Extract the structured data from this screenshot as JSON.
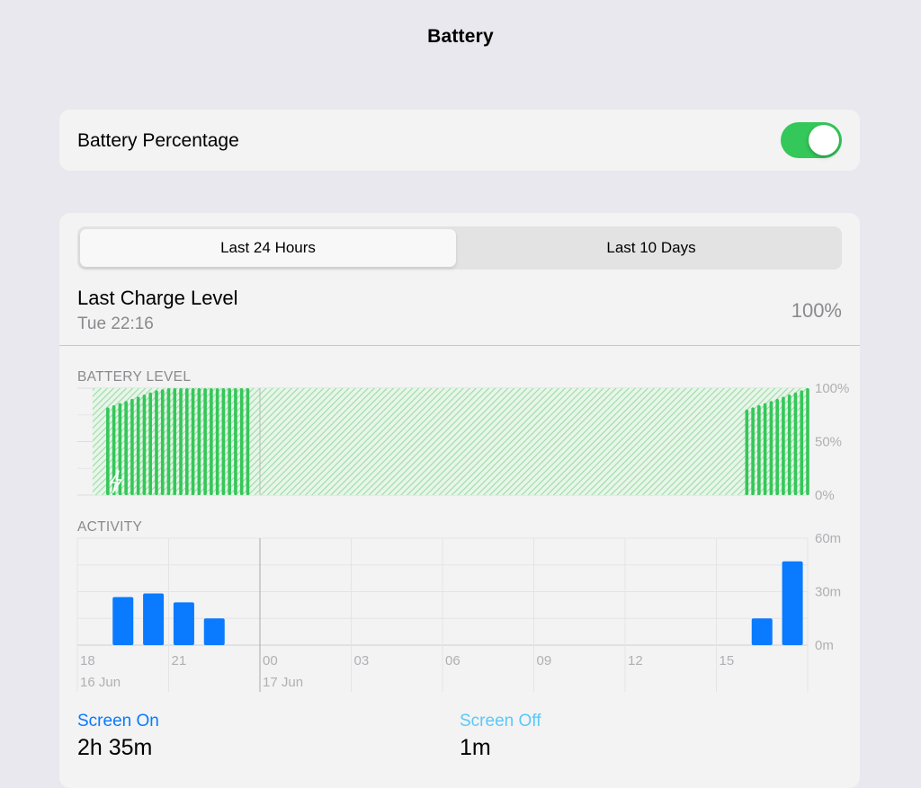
{
  "nav": {
    "title": "Battery"
  },
  "battery_percentage": {
    "label": "Battery Percentage",
    "enabled": true
  },
  "segmented": {
    "selected": "Last 24 Hours",
    "other": "Last 10 Days"
  },
  "last_charge": {
    "title": "Last Charge Level",
    "date": "Tue 22:16",
    "value": "100%"
  },
  "colors": {
    "battery_green": "#34c759",
    "hatch_green": "#bfe8c4",
    "activity_blue": "#0a7aff",
    "screen_off_blue": "#5ac8fa"
  },
  "charts": {
    "battery_label": "BATTERY LEVEL",
    "activity_label": "ACTIVITY",
    "battery_y_ticks": [
      "100%",
      "50%",
      "0%"
    ],
    "activity_y_ticks": [
      "60m",
      "30m",
      "0m"
    ],
    "x_ticks": [
      "18",
      "21",
      "00",
      "03",
      "06",
      "09",
      "12",
      "15"
    ],
    "x_dates": [
      "16 Jun",
      "17 Jun"
    ]
  },
  "chart_data": [
    {
      "type": "bar",
      "title": "BATTERY LEVEL",
      "unit": "%",
      "ylim": [
        0,
        100
      ],
      "y_ticks": [
        "0%",
        "50%",
        "100%"
      ],
      "x_ticks": [
        "18",
        "21",
        "00",
        "03",
        "06",
        "09",
        "12",
        "15"
      ],
      "x_dates": [
        "16 Jun",
        "17 Jun"
      ],
      "x_range_hours": [
        18,
        42
      ],
      "charging_period_hours": [
        18.5,
        42
      ],
      "series": [
        {
          "x_hours": [
            19.0,
            19.2,
            19.4,
            19.6,
            19.8,
            20.0,
            20.2,
            20.4,
            20.6,
            20.8,
            21.0,
            21.2,
            21.4,
            21.6,
            21.8,
            22.0,
            22.2,
            22.4,
            22.6,
            22.8,
            23.0,
            23.2,
            23.4,
            23.6
          ],
          "values": [
            82,
            84,
            86,
            88,
            90,
            92,
            94,
            96,
            98,
            99,
            100,
            100,
            100,
            100,
            100,
            100,
            100,
            100,
            100,
            100,
            100,
            100,
            100,
            100
          ]
        },
        {
          "x_hours": [
            40.0,
            40.2,
            40.4,
            40.6,
            40.8,
            41.0,
            41.2,
            41.4,
            41.6,
            41.8,
            42.0
          ],
          "values": [
            80,
            82,
            84,
            86,
            88,
            90,
            92,
            94,
            96,
            98,
            100
          ]
        }
      ]
    },
    {
      "type": "bar",
      "title": "ACTIVITY",
      "unit": "minutes",
      "ylim": [
        0,
        60
      ],
      "y_ticks": [
        "0m",
        "30m",
        "60m"
      ],
      "x_ticks": [
        "18",
        "21",
        "00",
        "03",
        "06",
        "09",
        "12",
        "15"
      ],
      "x_dates": [
        "16 Jun",
        "17 Jun"
      ],
      "series": [
        {
          "name": "Screen On",
          "categories": [
            "19",
            "20",
            "21",
            "22",
            "16",
            "17"
          ],
          "values": [
            27,
            29,
            24,
            15,
            15,
            47
          ]
        }
      ]
    }
  ],
  "usage": {
    "screen_on": {
      "label": "Screen On",
      "value": "2h 35m"
    },
    "screen_off": {
      "label": "Screen Off",
      "value": "1m"
    }
  }
}
